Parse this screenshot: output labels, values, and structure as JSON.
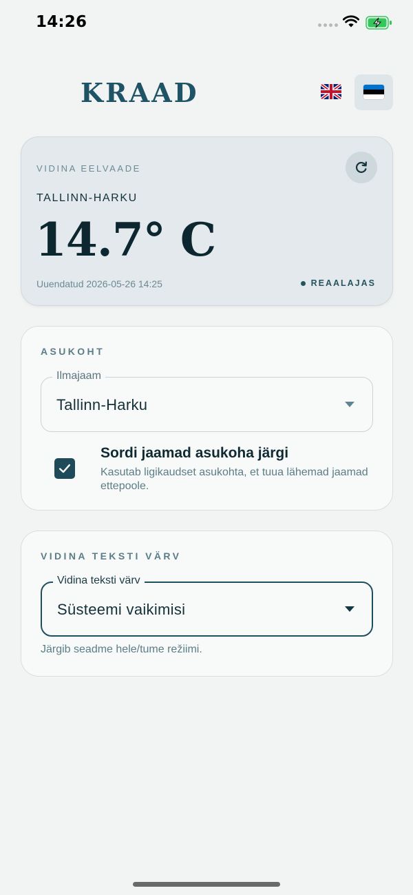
{
  "status_bar": {
    "time": "14:26",
    "icons": [
      "signal-dots-icon",
      "wifi-icon",
      "battery-charging-icon"
    ],
    "battery_color": "#34c759"
  },
  "header": {
    "logo": "KRAAD",
    "languages": [
      {
        "code": "en",
        "icon": "uk-flag-icon",
        "selected": false
      },
      {
        "code": "et",
        "icon": "estonia-flag-icon",
        "selected": true
      }
    ]
  },
  "preview": {
    "caption": "VIDINA EELVAADE",
    "refresh_icon": "refresh-icon",
    "station": "TALLINN-HARKU",
    "temperature": "14.7° C",
    "updated": "Uuendatud 2026-05-26 14:25",
    "live_label": "REAALAJAS"
  },
  "location": {
    "title": "ASUKOHT",
    "station_field": {
      "label": "Ilmajaam",
      "value": "Tallinn-Harku"
    },
    "sort_option": {
      "checked": true,
      "title": "Sordi jaamad asukoha järgi",
      "description": "Kasutab ligikaudset asukohta, et tuua lähemad jaamad ettepoole."
    }
  },
  "text_color": {
    "title": "VIDINA TEKSTI VÄRV",
    "field": {
      "label": "Vidina teksti värv",
      "value": "Süsteemi vaikimisi"
    },
    "helper": "Järgib seadme hele/tume režiimi."
  },
  "colors": {
    "accent": "#1f4a5a",
    "logo": "#1f5366",
    "background": "#f2f4f4"
  }
}
